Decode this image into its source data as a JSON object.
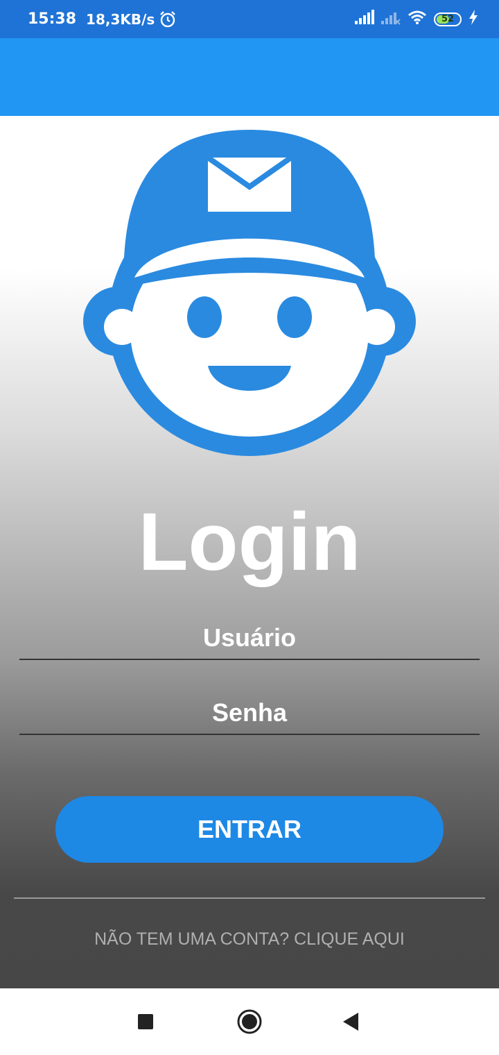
{
  "status_bar": {
    "time": "15:38",
    "net_speed": "18,3KB/s",
    "battery": "52",
    "icons": [
      "alarm-icon",
      "signal-icon",
      "signal-muted-icon",
      "wifi-icon",
      "battery-icon",
      "charging-icon"
    ]
  },
  "login": {
    "title": "Login",
    "username_placeholder": "Usuário",
    "password_placeholder": "Senha",
    "submit_label": "ENTRAR",
    "signup_link": "NÃO TEM UMA CONTA? CLIQUE AQUI"
  },
  "nav_bar": {
    "icons": [
      "recents-icon",
      "home-icon",
      "back-icon"
    ]
  },
  "colors": {
    "status_bar": "#1f73d6",
    "app_bar": "#2196f3",
    "accent": "#1e88e5"
  }
}
